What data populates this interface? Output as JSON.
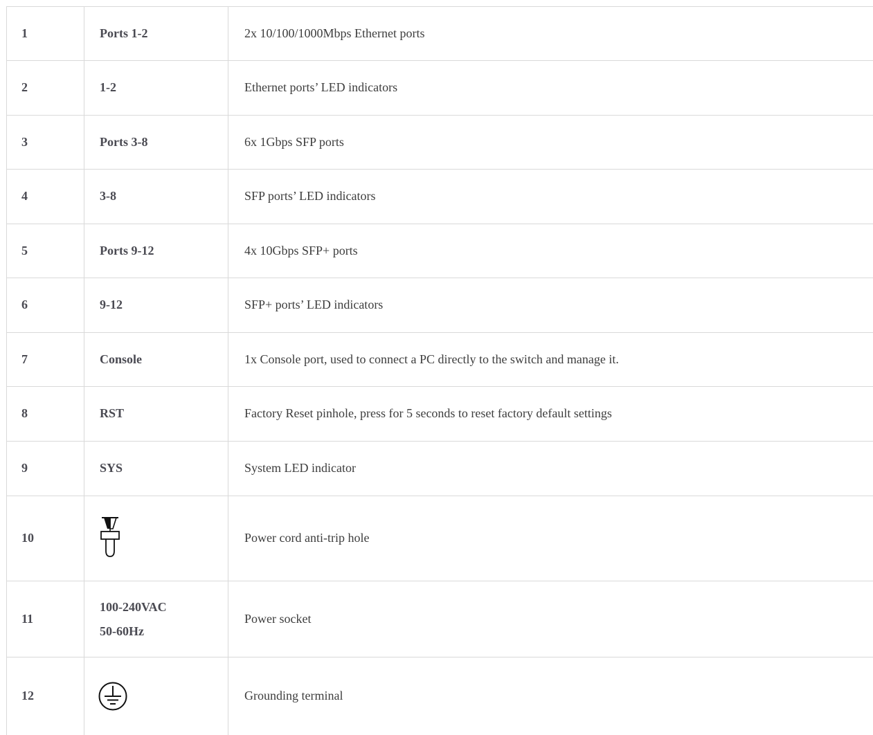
{
  "rows": [
    {
      "num": "1",
      "label": "Ports 1-2",
      "desc": "2x 10/100/1000Mbps Ethernet ports"
    },
    {
      "num": "2",
      "label": "1-2",
      "desc": "Ethernet ports’ LED indicators"
    },
    {
      "num": "3",
      "label": "Ports 3-8",
      "desc": "6x 1Gbps SFP ports"
    },
    {
      "num": "4",
      "label": "3-8",
      "desc": "SFP ports’ LED indicators"
    },
    {
      "num": "5",
      "label": "Ports 9-12",
      "desc": "4x 10Gbps SFP+ ports"
    },
    {
      "num": "6",
      "label": "9-12",
      "desc": "SFP+ ports’ LED indicators"
    },
    {
      "num": "7",
      "label": "Console",
      "desc": "1x Console port, used to connect a PC directly to the switch and manage it."
    },
    {
      "num": "8",
      "label": "RST",
      "desc": "Factory Reset pinhole, press for 5 seconds to reset factory default settings"
    },
    {
      "num": "9",
      "label": "SYS",
      "desc": "System LED indicator"
    },
    {
      "num": "10",
      "icon": "anti-trip-clip-icon",
      "desc": "Power cord anti-trip hole"
    },
    {
      "num": "11",
      "label_lines": [
        "100-240VAC",
        "50-60Hz"
      ],
      "desc": "Power socket"
    },
    {
      "num": "12",
      "icon": "ground-icon",
      "desc": "Grounding terminal"
    }
  ],
  "colors": {
    "border": "#d9d9d9",
    "text": "#3a3a3a"
  }
}
